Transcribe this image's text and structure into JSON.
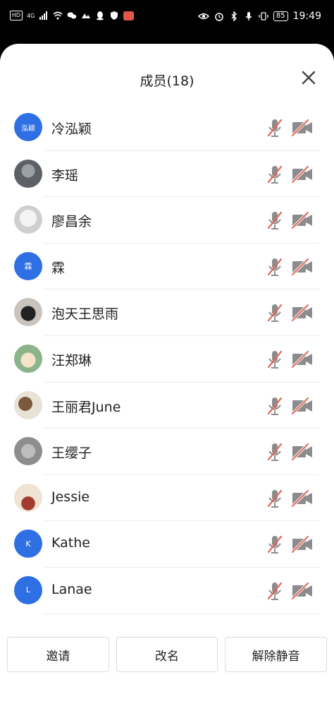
{
  "status_bar": {
    "left_chip": "HD",
    "signal": "4G",
    "battery": "85",
    "time": "19:49"
  },
  "panel": {
    "title": "成员(18)"
  },
  "members": [
    {
      "name": "冷泓颖",
      "avatar_text": "泓颖",
      "avatar_type": "initials"
    },
    {
      "name": "李瑶",
      "avatar_text": "",
      "avatar_type": "photo"
    },
    {
      "name": "廖昌余",
      "avatar_text": "",
      "avatar_type": "photo"
    },
    {
      "name": "霖",
      "avatar_text": "霖",
      "avatar_type": "initials"
    },
    {
      "name": "泡天王思雨",
      "avatar_text": "",
      "avatar_type": "photo"
    },
    {
      "name": "汪郑琳",
      "avatar_text": "",
      "avatar_type": "photo"
    },
    {
      "name": "王丽君June",
      "avatar_text": "",
      "avatar_type": "photo"
    },
    {
      "name": "王缨子",
      "avatar_text": "",
      "avatar_type": "photo"
    },
    {
      "name": "Jessie",
      "avatar_text": "",
      "avatar_type": "photo"
    },
    {
      "name": "Kathe",
      "avatar_text": "K",
      "avatar_type": "initials"
    },
    {
      "name": "Lanae",
      "avatar_text": "L",
      "avatar_type": "initials"
    }
  ],
  "buttons": {
    "invite": "邀请",
    "rename": "改名",
    "unmute": "解除静音"
  },
  "colors": {
    "avatar_blue": "#2f6fe4",
    "muted_slash": "#e0685a",
    "icon_gray": "#8c8c8c"
  }
}
